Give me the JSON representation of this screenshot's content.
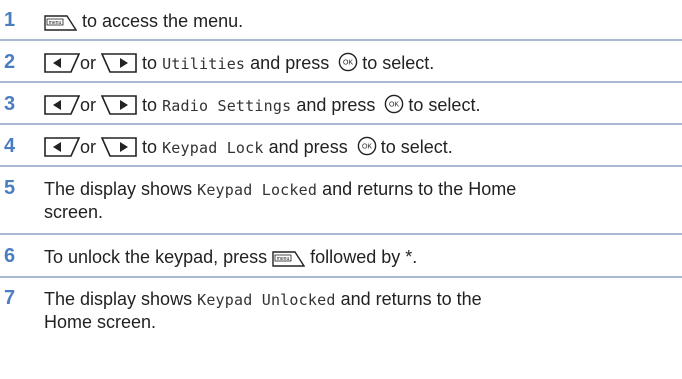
{
  "steps": [
    {
      "num": "1",
      "parts": {
        "text1": "to access the menu."
      }
    },
    {
      "num": "2",
      "parts": {
        "or": "or",
        "to": "to",
        "target": "Utilities",
        "press": "and press",
        "select": "to select."
      }
    },
    {
      "num": "3",
      "parts": {
        "or": "or",
        "to": "to",
        "target": "Radio Settings",
        "press": "and press",
        "select": "to select."
      }
    },
    {
      "num": "4",
      "parts": {
        "or": "or",
        "to": "to",
        "target": "Keypad Lock",
        "press": "and press",
        "select": "to select."
      }
    },
    {
      "num": "5",
      "parts": {
        "pre": "The display shows",
        "target": "Keypad Locked",
        "post": "and returns to the Home",
        "line2": "screen."
      }
    },
    {
      "num": "6",
      "parts": {
        "pre": "To unlock the keypad, press",
        "post": "followed by *."
      }
    },
    {
      "num": "7",
      "parts": {
        "pre": "The display shows",
        "target": "Keypad Unlocked",
        "post": "and returns to the",
        "line2": "Home screen."
      }
    }
  ],
  "icons": {
    "menu_key": "menu-key-icon",
    "left_key": "left-arrow-key-icon",
    "right_key": "right-arrow-key-icon",
    "ok_key": "ok-key-icon",
    "menu_key_label": "menu",
    "ok_key_label": "OK"
  },
  "colors": {
    "step_number": "#4a7ec0",
    "separator": "#a9b9d4"
  }
}
